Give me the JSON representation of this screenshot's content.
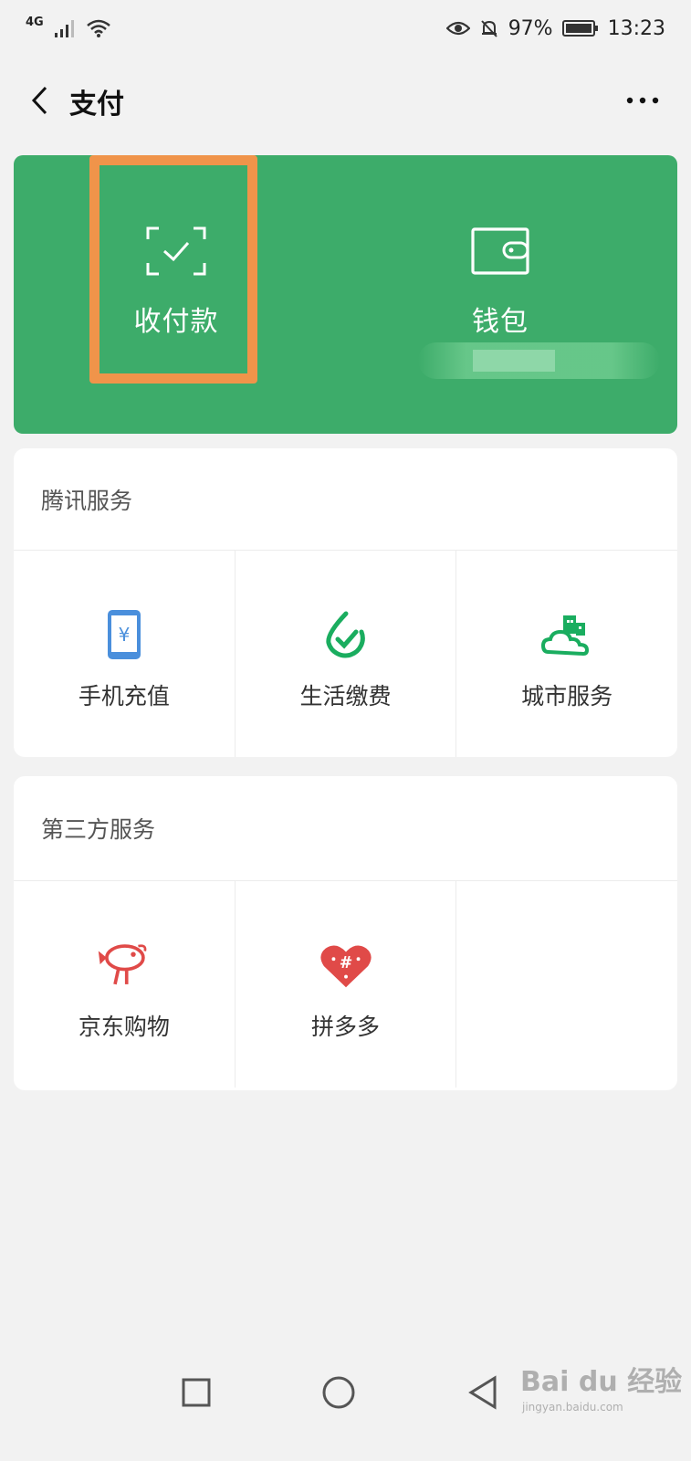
{
  "status_bar": {
    "network": "4G",
    "battery": "97%",
    "time": "13:23"
  },
  "header": {
    "title": "支付"
  },
  "pay_card": {
    "receive_pay_label": "收付款",
    "wallet_label": "钱包"
  },
  "tencent_services": {
    "title": "腾讯服务",
    "items": [
      {
        "label": "手机充值",
        "icon": "phone-recharge-icon"
      },
      {
        "label": "生活缴费",
        "icon": "utility-payment-icon"
      },
      {
        "label": "城市服务",
        "icon": "city-service-icon"
      }
    ]
  },
  "third_party_services": {
    "title": "第三方服务",
    "items": [
      {
        "label": "京东购物",
        "icon": "jd-icon"
      },
      {
        "label": "拼多多",
        "icon": "pinduoduo-icon"
      }
    ]
  },
  "watermark": {
    "text": "Bai du 经验",
    "sub": "jingyan.baidu.com"
  },
  "colors": {
    "card_green": "#3dac6a",
    "highlight_orange": "#f0944a",
    "icon_green": "#1aad5f",
    "icon_blue": "#4a8fdc",
    "icon_red": "#e04a48"
  }
}
